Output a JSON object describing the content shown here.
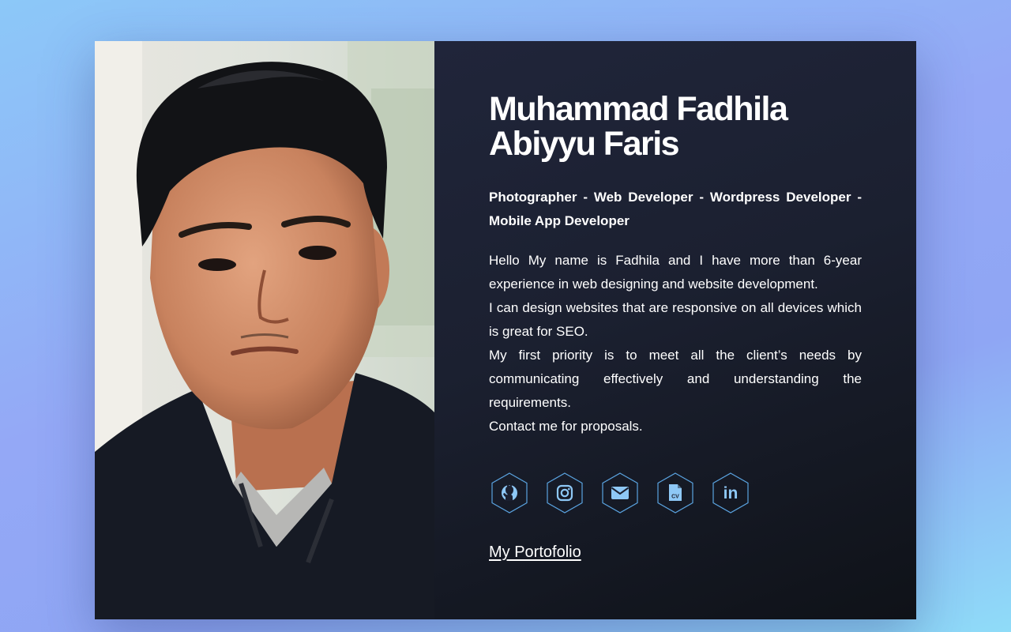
{
  "profile": {
    "name_line1": "Muhammad Fadhila",
    "name_line2": "Abiyyu Faris",
    "roles": "Photographer - Web Developer - Wordpress Developer - Mobile App Developer",
    "bio": [
      "Hello My name is Fadhila and I have more than 6-year experience in web designing and website development.",
      "I can design websites that are responsive on all devices which is great for SEO.",
      "My first priority is to meet all the client’s needs by communicating effectively and understanding the requirements.",
      "Contact me for proposals."
    ]
  },
  "socials": [
    {
      "icon": "github-icon"
    },
    {
      "icon": "instagram-icon"
    },
    {
      "icon": "envelope-icon"
    },
    {
      "icon": "cv-file-icon",
      "text": "CV"
    },
    {
      "icon": "linkedin-icon",
      "text": "in"
    }
  ],
  "portfolio_link": "My Portofolio",
  "colors": {
    "accent": "#8ec8f6",
    "panel_bg": "#1b2030",
    "text": "#ffffff"
  }
}
